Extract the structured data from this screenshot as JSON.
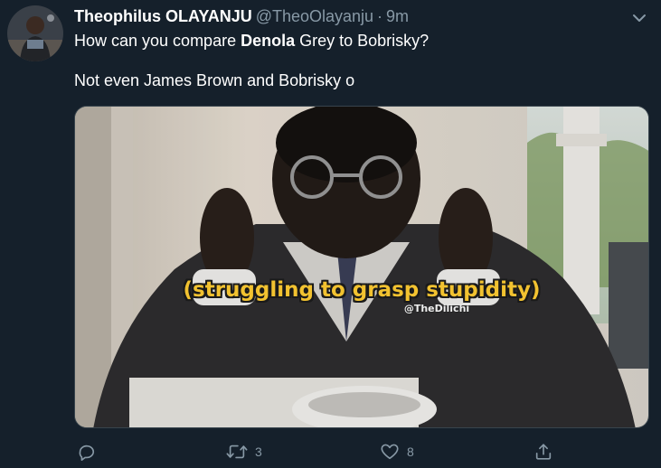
{
  "tweet": {
    "display_name": "Theophilus OLAYANJU",
    "handle": "@TheoOlayanju",
    "separator": "·",
    "time": "9m",
    "text_line1_before": "How can you compare ",
    "text_line1_bold": "Denola",
    "text_line1_after": " Grey to Bobrisky?",
    "text_line2": "Not even James Brown and Bobrisky o"
  },
  "media": {
    "caption": "(struggling to grasp stupidity)",
    "watermark": "@TheDilichi"
  },
  "actions": {
    "reply_icon": "reply-icon",
    "retweet_icon": "retweet-icon",
    "retweet_count": "3",
    "like_icon": "like-icon",
    "like_count": "8",
    "share_icon": "share-icon"
  },
  "colors": {
    "background": "#15202b",
    "secondary_text": "#8899a6",
    "primary_text": "#ffffff",
    "caption_yellow": "#f2c230"
  }
}
